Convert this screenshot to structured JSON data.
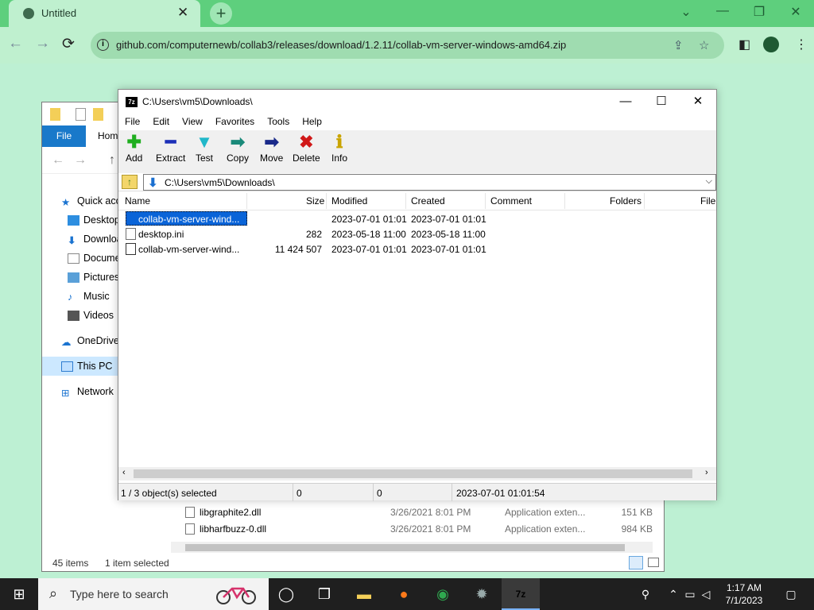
{
  "browser": {
    "tab_title": "Untitled",
    "tab_close": "✕",
    "new_tab": "+",
    "url": "github.com/computernewb/collab3/releases/download/1.2.11/collab-vm-server-windows-amd64.zip",
    "info_glyph": "i",
    "win_controls": [
      "⌄",
      "—",
      "❐",
      "✕"
    ],
    "nav": {
      "back": "←",
      "forward": "→",
      "reload": "⟳"
    },
    "toolbar_icons": [
      "share-icon",
      "star-icon",
      "sidebar-icon",
      "profile-icon",
      "menu-icon"
    ],
    "accent": "#5ecf7d"
  },
  "explorer": {
    "ribbon_file": "File",
    "ribbon_home": "Home",
    "sidebar": [
      {
        "label": "Quick access",
        "icon": "star-icon"
      },
      {
        "label": "Desktop",
        "icon": "desktop-icon"
      },
      {
        "label": "Downloads",
        "icon": "download-icon"
      },
      {
        "label": "Documents",
        "icon": "documents-icon"
      },
      {
        "label": "Pictures",
        "icon": "pictures-icon"
      },
      {
        "label": "Music",
        "icon": "music-icon"
      },
      {
        "label": "Videos",
        "icon": "videos-icon"
      },
      {
        "label": "OneDrive",
        "icon": "cloud-icon"
      },
      {
        "label": "This PC",
        "icon": "pc-icon"
      },
      {
        "label": "Network",
        "icon": "network-icon"
      }
    ],
    "rows": [
      {
        "name": "libgraphite2.dll",
        "date": "3/26/2021 8:01 PM",
        "type": "Application exten...",
        "size": "151 KB"
      },
      {
        "name": "libharfbuzz-0.dll",
        "date": "3/26/2021 8:01 PM",
        "type": "Application exten...",
        "size": "984 KB"
      }
    ],
    "status_items": "45 items",
    "status_selected": "1 item selected"
  },
  "zip": {
    "title": "C:\\Users\\vm5\\Downloads\\",
    "logo": "7z",
    "menu": [
      "File",
      "Edit",
      "View",
      "Favorites",
      "Tools",
      "Help"
    ],
    "tools": [
      {
        "label": "Add",
        "glyph": "✚",
        "color": "#1fae1f"
      },
      {
        "label": "Extract",
        "glyph": "━",
        "color": "#1c2fb8"
      },
      {
        "label": "Test",
        "glyph": "▼",
        "color": "#20b7c9"
      },
      {
        "label": "Copy",
        "glyph": "➡",
        "color": "#1a8a7a"
      },
      {
        "label": "Move",
        "glyph": "➡",
        "color": "#1a2a8a"
      },
      {
        "label": "Delete",
        "glyph": "✖",
        "color": "#d01818"
      },
      {
        "label": "Info",
        "glyph": "ℹ",
        "color": "#c9a400"
      }
    ],
    "path": "C:\\Users\\vm5\\Downloads\\",
    "columns": [
      "Name",
      "Size",
      "Modified",
      "Created",
      "Comment",
      "Folders",
      "File"
    ],
    "files": [
      {
        "name": "collab-vm-server-wind...",
        "size": "",
        "modified": "2023-07-01 01:01",
        "created": "2023-07-01 01:01",
        "selected": true,
        "icon": "folder-file-icon"
      },
      {
        "name": "desktop.ini",
        "size": "282",
        "modified": "2023-05-18 11:00",
        "created": "2023-05-18 11:00",
        "selected": false,
        "icon": "ini-file-icon"
      },
      {
        "name": "collab-vm-server-wind...",
        "size": "11 424 507",
        "modified": "2023-07-01 01:01",
        "created": "2023-07-01 01:01",
        "selected": false,
        "icon": "zip-file-icon"
      }
    ],
    "status": {
      "selected": "1 / 3 object(s) selected",
      "size1": "0",
      "size2": "0",
      "date": "2023-07-01 01:01:54"
    }
  },
  "taskbar": {
    "search_placeholder": "Type here to search",
    "time": "1:17 AM",
    "date": "7/1/2023",
    "apps": [
      "cortana-icon",
      "task-view-icon",
      "file-explorer-icon",
      "firefox-icon",
      "chrome-icon",
      "app-icon",
      "7zip-icon"
    ]
  }
}
